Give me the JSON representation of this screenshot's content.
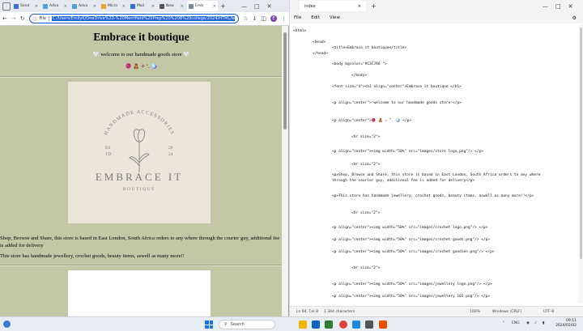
{
  "browser": {
    "tabs": [
      {
        "label": "Send",
        "color": "#3b6fd4",
        "active": false
      },
      {
        "label": "Adva",
        "color": "#4aa3df",
        "active": false
      },
      {
        "label": "Adva",
        "color": "#4aa3df",
        "active": false
      },
      {
        "label": "Micro",
        "color": "#e8a33b",
        "active": false
      },
      {
        "label": "Mail",
        "color": "#2f6fd6",
        "active": false
      },
      {
        "label": "New",
        "color": "#555555",
        "active": false
      },
      {
        "label": "Emb",
        "color": "#7a8a9a",
        "active": true
      }
    ],
    "address": {
      "scheme_label": "File",
      "url": "C:/Users/EmilyK/OneDrive%20-%20Merrifield%20Prep%20%208%20college/2024/HTML/lesson%"
    },
    "profile_initial": "E",
    "page": {
      "title": "Embrace it boutique",
      "welcome": "🤍 welcome to our handmade goods store 🤍",
      "emoji_line": "🧶 🧸 ✧ ˚. 🪩",
      "logo": {
        "arc_text": "HANDMADE ACCESSORIES",
        "es": "ES",
        "td": "TD",
        "y1": "20",
        "y2": "24",
        "brand": "EMBRACE IT",
        "sub": "BOUTIQUE"
      },
      "about": "Shop, Browse and Share, this store is based in East London, South Africa orders to any where through the courier guy, additional fee is added for delivery",
      "about2": "This store has handmade jewellery, crochet goods, beauty items, aswell as many more!!"
    }
  },
  "notepad": {
    "tab_title": "index",
    "menu": [
      "File",
      "Edit",
      "View"
    ],
    "code": [
      "<html>",
      "<head>",
      "<title>Embrace it boutique</title>",
      "</head>",
      "<body bgcolor=\"#C3C7A6 \">",
      "</body>",
      "<font size=\"4\"><h1 align=\"center\">Embrace it boutique </h1>",
      "<p align=\"center\">♡welcome to our handmade goods store♡</p>",
      "<p align=\"center\">🧶 🧸 ✧ ˚. 🪩 </p>",
      "<hr size=\"2\">",
      "<p align=\"center\"><img width=\"50%\" src=\"images/store logo.png\"/> </p>",
      "<hr size=\"2\">",
      "<p>Shop, Browse and Share, this store is based in East London, South Africa orders to any where",
      "through the courier guy, additional fee is added for delivery</p>",
      "<p>This store has handmade jewellery, crochet goods, beauty items, aswell as many more!!</p>",
      "<hr size=\"2\">",
      "<p align=\"center\"><img width=\"50%\" src=\"images/crochet logo.png\"/> </p>",
      "<p align=\"center\"><img width=\"50%\" src=\"images/crochet goods.png\"/> </p>",
      "<p align=\"center\"><img width=\"50%\" src=\"images/crochet goodies.png\"/> </p>",
      "<hr size=\"2\">",
      "<p align=\"center\"><img width=\"50%\" src=\"images/jewellery logo.png\"/> </p>",
      "<p align=\"center\"><img width=\"50%\" src=\"images/jewellery 101.png\"/> </p>"
    ],
    "status": {
      "position": "Ln 64, Col 8",
      "characters": "1 344 characters",
      "zoom": "100%",
      "line_ending": "Windows (CRLF)",
      "encoding": "UTF-8"
    }
  },
  "taskbar": {
    "search_label": "Search",
    "language": "ENG",
    "time": "09:11",
    "date": "2024/02/02"
  }
}
